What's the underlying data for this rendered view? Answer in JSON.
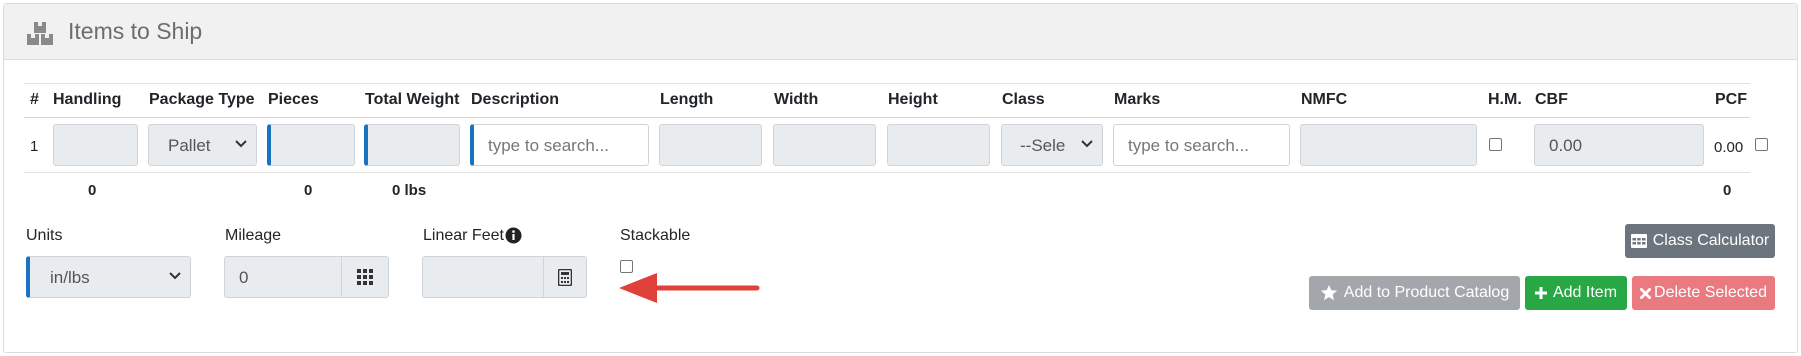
{
  "header": {
    "title": "Items to Ship",
    "icon": "boxes-icon"
  },
  "table": {
    "columns": [
      "#",
      "Handling",
      "Package Type",
      "Pieces",
      "Total Weight",
      "Description",
      "Length",
      "Width",
      "Height",
      "Class",
      "Marks",
      "NMFC",
      "H.M.",
      "CBF",
      "PCF"
    ],
    "row": {
      "number": "1",
      "package_type": "Pallet",
      "description_placeholder": "type to search...",
      "class_value": "--Sele",
      "marks_placeholder": "type to search...",
      "cbf": "0.00",
      "pcf": "0.00"
    },
    "totals": {
      "handling": "0",
      "pieces": "0",
      "weight": "0 lbs",
      "pcf": "0"
    }
  },
  "form": {
    "units_label": "Units",
    "units_value": "in/lbs",
    "mileage_label": "Mileage",
    "mileage_value": "0",
    "linear_feet_label": "Linear Feet",
    "stackable_label": "Stackable"
  },
  "buttons": {
    "class_calculator": "Class Calculator",
    "add_to_catalog": "Add to Product Catalog",
    "add_item": "Add Item",
    "delete_selected": "Delete Selected"
  },
  "colors": {
    "accent": "#1a73c2",
    "grey_button": "#a3a7ab",
    "dark_button": "#6c757d",
    "success": "#28a745",
    "danger": "#ea7a80",
    "annotation_arrow": "#e0403a"
  }
}
